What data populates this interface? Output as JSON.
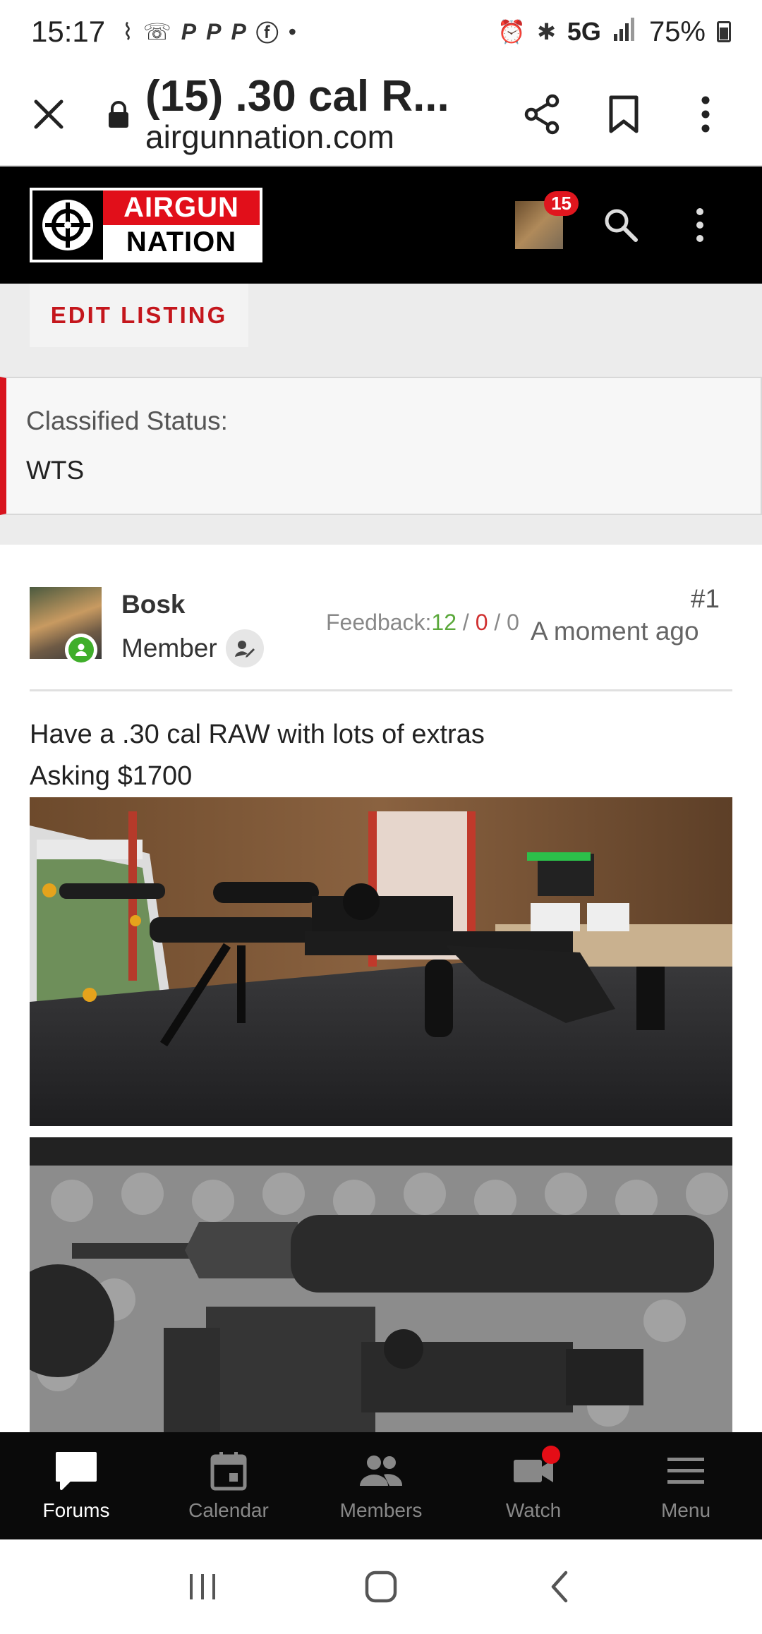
{
  "status_bar": {
    "time": "15:17",
    "network": "5G",
    "battery": "75%",
    "left_icons": [
      "hearing-aid-icon",
      "wifi-call-icon",
      "paypal-icon",
      "paypal-icon",
      "paypal-icon",
      "facebook-icon",
      "dot-icon"
    ],
    "right_icons": [
      "alarm-icon",
      "bluetooth-icon",
      "signal-icon",
      "battery-icon"
    ]
  },
  "browser": {
    "title": "(15) .30 cal R...",
    "url": "airgunnation.com"
  },
  "site": {
    "logo_top": "AIRGUN",
    "logo_bottom": "NATION",
    "notifications": "15",
    "brand_color": "#e10f1a"
  },
  "listing": {
    "edit_label": "EDIT LISTING",
    "status_label": "Classified Status:",
    "status_value": "WTS"
  },
  "post": {
    "username": "Bosk",
    "role": "Member",
    "post_number": "#1",
    "feedback_label": "Feedback:",
    "feedback_positive": "12",
    "feedback_neutral": "0",
    "feedback_negative": "0",
    "sep": " / ",
    "timestamp": "A moment ago",
    "body_line1": "Have a .30 cal RAW with lots of extras",
    "body_line2": "Asking $1700"
  },
  "bottom_nav": [
    {
      "label": "Forums",
      "icon": "chat-bubble-icon",
      "active": true
    },
    {
      "label": "Calendar",
      "icon": "calendar-icon"
    },
    {
      "label": "Members",
      "icon": "members-icon"
    },
    {
      "label": "Watch",
      "icon": "video-camera-icon"
    },
    {
      "label": "Menu",
      "icon": "hamburger-icon"
    }
  ]
}
